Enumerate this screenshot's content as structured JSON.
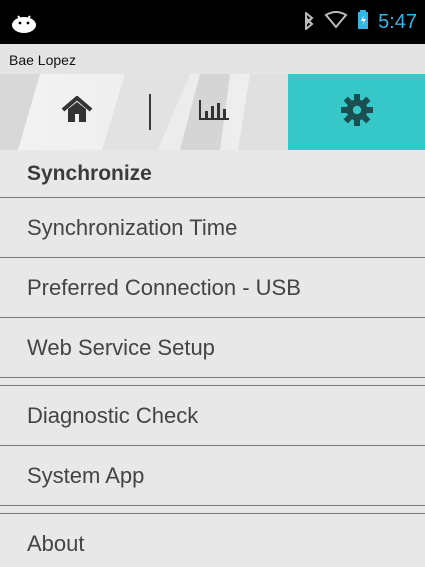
{
  "status_bar": {
    "time": "5:47",
    "icons": [
      "android-icon",
      "bluetooth-icon",
      "wifi-icon",
      "battery-icon"
    ]
  },
  "user": {
    "name": "Bae Lopez"
  },
  "tabs": [
    {
      "label": "home",
      "icon": "home-icon"
    },
    {
      "label": "statistics",
      "icon": "bar-chart-icon"
    },
    {
      "label": "settings",
      "icon": "gear-icon",
      "selected": true
    }
  ],
  "menu": {
    "header": "Synchronize",
    "items": [
      "Synchronization Time",
      "Preferred Connection - USB",
      "Web Service Setup",
      "Diagnostic Check",
      "System App",
      "About"
    ]
  },
  "colors": {
    "accent": "#36c8c9",
    "status_time": "#33b5e5"
  }
}
